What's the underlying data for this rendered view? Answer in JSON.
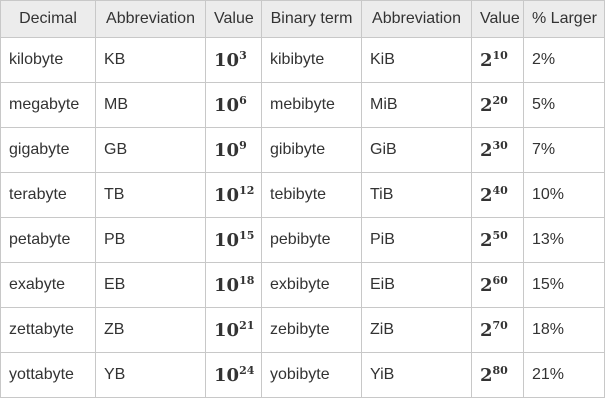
{
  "headers": [
    "Decimal",
    "Abbreviation",
    "Value",
    "Binary term",
    "Abbreviation",
    "Value",
    "% Larger"
  ],
  "rows": [
    {
      "decimal": "kilobyte",
      "dec_abbr": "KB",
      "dec_base": "10",
      "dec_exp": "3",
      "binary": "kibibyte",
      "bin_abbr": "KiB",
      "bin_base": "2",
      "bin_exp": "10",
      "larger": "2%"
    },
    {
      "decimal": "megabyte",
      "dec_abbr": "MB",
      "dec_base": "10",
      "dec_exp": "6",
      "binary": "mebibyte",
      "bin_abbr": "MiB",
      "bin_base": "2",
      "bin_exp": "20",
      "larger": "5%"
    },
    {
      "decimal": "gigabyte",
      "dec_abbr": "GB",
      "dec_base": "10",
      "dec_exp": "9",
      "binary": "gibibyte",
      "bin_abbr": "GiB",
      "bin_base": "2",
      "bin_exp": "30",
      "larger": "7%"
    },
    {
      "decimal": "terabyte",
      "dec_abbr": "TB",
      "dec_base": "10",
      "dec_exp": "12",
      "binary": "tebibyte",
      "bin_abbr": "TiB",
      "bin_base": "2",
      "bin_exp": "40",
      "larger": "10%"
    },
    {
      "decimal": "petabyte",
      "dec_abbr": "PB",
      "dec_base": "10",
      "dec_exp": "15",
      "binary": "pebibyte",
      "bin_abbr": "PiB",
      "bin_base": "2",
      "bin_exp": "50",
      "larger": "13%"
    },
    {
      "decimal": "exabyte",
      "dec_abbr": "EB",
      "dec_base": "10",
      "dec_exp": "18",
      "binary": "exbibyte",
      "bin_abbr": "EiB",
      "bin_base": "2",
      "bin_exp": "60",
      "larger": "15%"
    },
    {
      "decimal": "zettabyte",
      "dec_abbr": "ZB",
      "dec_base": "10",
      "dec_exp": "21",
      "binary": "zebibyte",
      "bin_abbr": "ZiB",
      "bin_base": "2",
      "bin_exp": "70",
      "larger": "18%"
    },
    {
      "decimal": "yottabyte",
      "dec_abbr": "YB",
      "dec_base": "10",
      "dec_exp": "24",
      "binary": "yobibyte",
      "bin_abbr": "YiB",
      "bin_base": "2",
      "bin_exp": "80",
      "larger": "21%"
    }
  ]
}
